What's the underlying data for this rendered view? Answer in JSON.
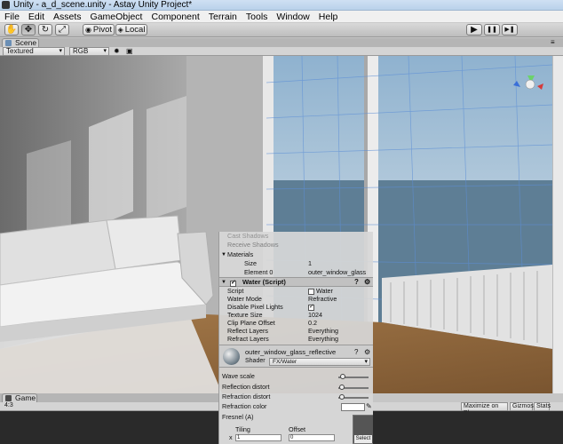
{
  "window": {
    "title": "Unity - a_d_scene.unity - Astay Unity Project*"
  },
  "menu": [
    "File",
    "Edit",
    "Assets",
    "GameObject",
    "Component",
    "Terrain",
    "Tools",
    "Window",
    "Help"
  ],
  "toolbar": {
    "tools": [
      "hand-tool",
      "move-tool",
      "rotate-tool",
      "scale-tool"
    ],
    "pivot_label": "Pivot",
    "local_label": "Local",
    "play": "▶",
    "pause": "❚❚",
    "step": "▶❚"
  },
  "scene": {
    "tab_label": "Scene",
    "render_mode": "Textured",
    "color_mode": "RGB"
  },
  "inspector": {
    "faded_rows": [
      "Cast Shadows",
      "Receive Shadows"
    ],
    "materials_label": "Materials",
    "size_label": "Size",
    "size_value": "1",
    "element0_label": "Element 0",
    "element0_value": "outer_window_glass",
    "water_component": "Water (Script)",
    "rows": [
      {
        "label": "Script",
        "value": "Water",
        "type": "object"
      },
      {
        "label": "Water Mode",
        "value": "Refractive",
        "type": "dropdown"
      },
      {
        "label": "Disable Pixel Lights",
        "value": "",
        "type": "checkbox"
      },
      {
        "label": "Texture Size",
        "value": "1024",
        "type": "text"
      },
      {
        "label": "Clip Plane Offset",
        "value": "0.2",
        "type": "text"
      },
      {
        "label": "Reflect Layers",
        "value": "Everything",
        "type": "dropdown"
      },
      {
        "label": "Refract Layers",
        "value": "Everything",
        "type": "dropdown"
      }
    ],
    "material_name": "outer_window_glass_reflective",
    "shader_label": "Shader",
    "shader_value": "FX/Water",
    "props": [
      {
        "label": "Wave scale",
        "knob": 0.1
      },
      {
        "label": "Reflection distort",
        "knob": 0.05
      },
      {
        "label": "Refraction distort",
        "knob": 0.05
      }
    ],
    "refraction_color_label": "Refraction color",
    "fresnel_label": "Fresnel (A)",
    "tiling_label": "Tiling",
    "offset_label": "Offset",
    "x_label": "x",
    "tiling_x": "1",
    "offset_x": "0",
    "select_label": "Select"
  },
  "game": {
    "tab_label": "Game",
    "aspect": "4:3",
    "maximize_on_play": "Maximize on Play",
    "gizmos": "Gizmos",
    "stats": "Stats"
  }
}
